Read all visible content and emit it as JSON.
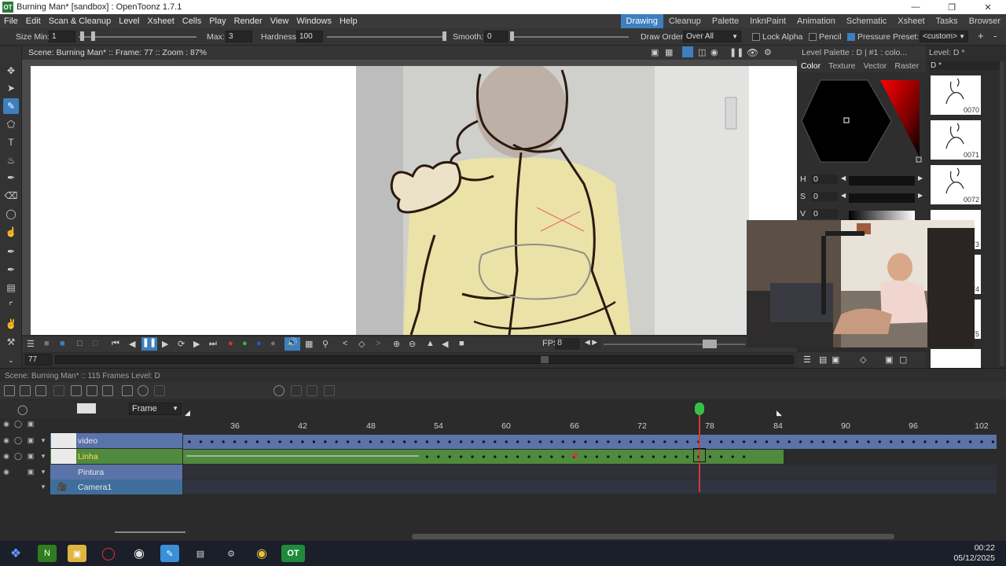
{
  "window": {
    "title": "Burning Man* [sandbox] : OpenToonz 1.7.1",
    "app_icon": "OT"
  },
  "menu": [
    "File",
    "Edit",
    "Scan & Cleanup",
    "Level",
    "Xsheet",
    "Cells",
    "Play",
    "Render",
    "View",
    "Windows",
    "Help"
  ],
  "rooms": [
    {
      "label": "Drawing",
      "active": true
    },
    {
      "label": "Cleanup",
      "active": false
    },
    {
      "label": "Palette",
      "active": false
    },
    {
      "label": "InknPaint",
      "active": false
    },
    {
      "label": "Animation",
      "active": false
    },
    {
      "label": "Schematic",
      "active": false
    },
    {
      "label": "Xsheet",
      "active": false
    },
    {
      "label": "Tasks",
      "active": false
    },
    {
      "label": "Browser",
      "active": false
    }
  ],
  "tool_options": {
    "size_min_label": "Size Min:",
    "size_min": "1",
    "max_label": "Max:",
    "max": "3",
    "hardness_label": "Hardness:",
    "hardness": "100",
    "smooth_label": "Smooth:",
    "smooth": "0",
    "draw_order_label": "Draw Order:",
    "draw_order": "Over All",
    "lock_alpha": "Lock Alpha",
    "pencil": "Pencil",
    "pressure": "Pressure",
    "preset_label": "Preset:",
    "preset": "<custom>",
    "add": "+",
    "remove": "-"
  },
  "viewer": {
    "info": "Scene: Burning Man*  ::  Frame: 77  ::  Zoom : 87%"
  },
  "playback": {
    "fps_label": "FPS",
    "fps": "8",
    "frame_field": "77"
  },
  "palette": {
    "title": "Level Palette : D | #1 : colo...",
    "tabs": [
      "Color",
      "Texture",
      "Vector",
      "Raster"
    ],
    "active_tab": "Color",
    "h_label": "H",
    "h": "0",
    "s_label": "S",
    "s": "0",
    "v_label": "V",
    "v": "0"
  },
  "level_strip": {
    "title": "Level: D *",
    "level_name": "D *",
    "frames": [
      "0070",
      "0071",
      "0072",
      "0073",
      "0074",
      "0075"
    ]
  },
  "xsheet": {
    "info": "Scene: Burning Man*  ::  115 Frames  Level: D",
    "frame_mode": "Frame",
    "ruler": [
      "36",
      "42",
      "48",
      "54",
      "60",
      "66",
      "72",
      "78",
      "84",
      "90",
      "96",
      "102"
    ],
    "current_frame": "78",
    "layers": [
      {
        "name": "video",
        "color": "#5a73a8"
      },
      {
        "name": "Linha",
        "color": "#4f8a3e"
      },
      {
        "name": "Pintura",
        "color": "#5a73a8"
      },
      {
        "name": "Camera1",
        "color": "#3f6e9c"
      }
    ]
  },
  "taskbar": {
    "icons": [
      "windows-start",
      "search",
      "nvidia",
      "file-explorer",
      "opera",
      "obs",
      "sketchbook",
      "notes",
      "steam",
      "chrome",
      "opentoonz"
    ],
    "time": "00:22",
    "date": "05/12/2025"
  }
}
